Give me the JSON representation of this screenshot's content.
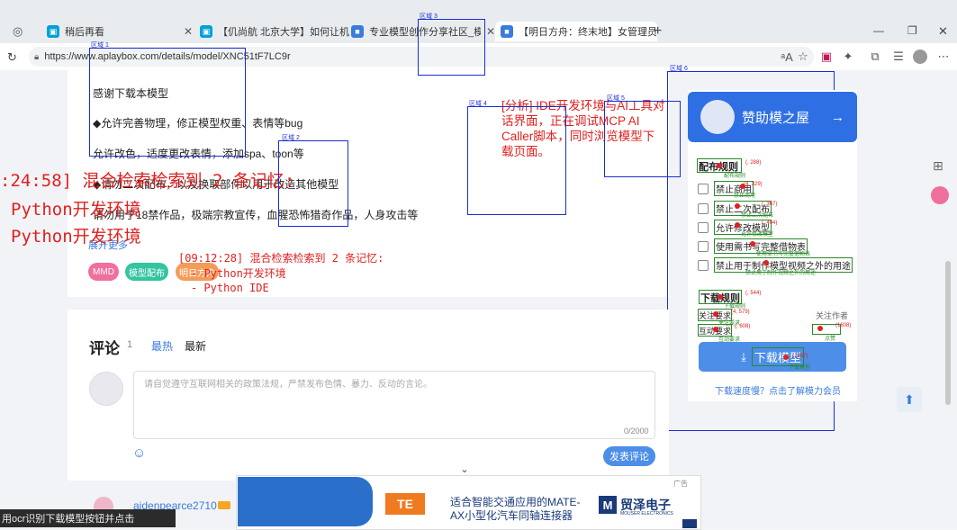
{
  "tabs": [
    {
      "label": "稍后再看",
      "icon": "bilibili-icon"
    },
    {
      "label": "【仉尚航 北京大学】如何让机器人",
      "icon": "bilibili-icon"
    },
    {
      "label": "专业模型创作分享社区_模之屋_Pla",
      "icon": "playbox-icon"
    },
    {
      "label": "【明日方舟：终末地】女管理员",
      "icon": "playbox-icon"
    }
  ],
  "url": "https://www.aplaybox.com/details/model/XNC51tF7LC9r",
  "description": {
    "line1": "感谢下载本模型",
    "line2": "◆允许完善物理，修正模型权重、表情等bug",
    "line3": "允许改色，适度更改表情，添加spa、toon等",
    "line4": "◆请勿二次配布，以及换取部件以用于改造其他模型",
    "line5": "请勿用于18禁作品，极端宗教宣传，血腥恐怖猎奇作品，人身攻击等",
    "expand": "展开更多"
  },
  "tags": [
    "MMD",
    "模型配布",
    "明日方舟"
  ],
  "overlay": {
    "memory_big_time": ":24:58] 混合检索检索到 2 条记忆:",
    "memory_big_1": "Python开发环境",
    "memory_big_2": "Python开发环境",
    "memory_small_time": "[09:12:28] 混合检索检索到 2 条记忆:",
    "memory_small_1": "- Python开发环境",
    "memory_small_2": "- Python IDE",
    "analysis": "[分析] IDE开发环境与AI工具对话界面，正在调试MCP AI Caller脚本，同时浏览模型下载页面。"
  },
  "regions": [
    "区域 1",
    "区域 2",
    "区域 3",
    "区域 4",
    "区域 5",
    "区域 6"
  ],
  "comments": {
    "title": "评论",
    "count": "1",
    "sort_hot": "最热",
    "sort_new": "最新",
    "placeholder": "请自觉遵守互联网相关的政策法规，严禁发布色情、暴力、反动的言论。",
    "counter": "0/2000",
    "submit": "发表评论",
    "first_user": "aidenpearce2710"
  },
  "sidebar": {
    "sponsor": "赞助模之屋",
    "rules_title": "配布规则",
    "rules": [
      "禁止商用",
      "禁止二次配布",
      "允许修改模型",
      "使用需书写完整借物表",
      "禁止用于制作模型视频之外的用途"
    ],
    "rule_captions": [
      "禁止商用",
      "禁止二次配布",
      "允许修改模型",
      "使用需书写完整借物表",
      "禁止用于制作视频之外的用途"
    ],
    "rules_caption": "配布规则",
    "download_title": "下载规则",
    "download_caption": "下载规则",
    "dl_items": [
      "关注要求",
      "互动要求"
    ],
    "dl_captions": [
      "关注要求",
      "互动要求"
    ],
    "follow_author": "关注作者",
    "follow_caption": "点赞",
    "download_btn": "下载模型",
    "download_btn_caption": "下载模型",
    "help_link": "下载速度慢？点击了解模力会员",
    "coords": [
      "(, 288)",
      "(4, 329)",
      "(, 367)",
      "(, 404)",
      "(, 544)",
      "(4, 579)",
      "(, 608)",
      "(1608)",
      "(, 667)"
    ]
  },
  "ad": {
    "badge": "广告",
    "text_line1": "适合智能交通应用的MATE-",
    "text_line2": "AX小型化汽车同轴连接器",
    "brand": "贸泽电子",
    "brand_sub": "MOUSER ELECTRONICS",
    "te": "TE"
  },
  "status_text": "用ocr识别下载模型按钮并点击"
}
